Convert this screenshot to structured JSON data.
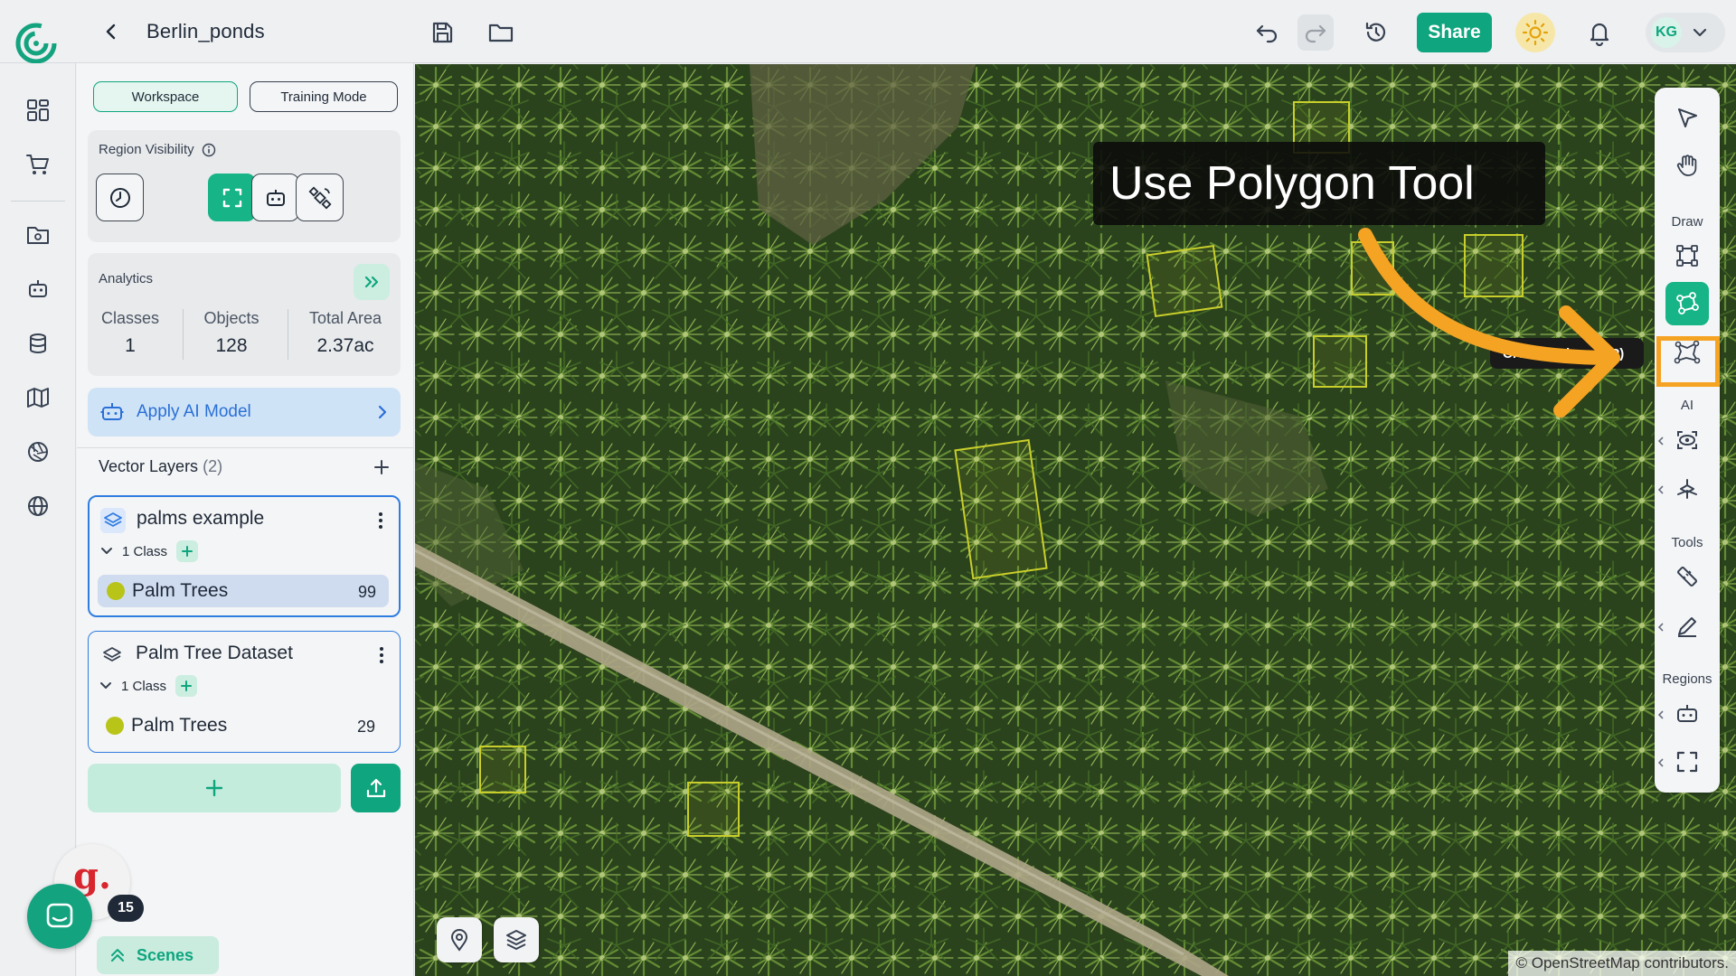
{
  "header": {
    "project_title": "Berlin_ponds",
    "share_label": "Share",
    "avatar_initials": "KG"
  },
  "panel": {
    "modes": {
      "workspace": "Workspace",
      "training": "Training Mode"
    },
    "region_visibility": {
      "title": "Region Visibility"
    },
    "analytics": {
      "title": "Analytics",
      "stats": [
        {
          "label": "Classes",
          "value": "1"
        },
        {
          "label": "Objects",
          "value": "128"
        },
        {
          "label": "Total Area",
          "value": "2.37ac"
        }
      ]
    },
    "apply_ai_label": "Apply AI Model",
    "vector_layers": {
      "title": "Vector Layers",
      "count": "(2)",
      "layers": [
        {
          "name": "palms example",
          "class_summary": "1 Class",
          "classes": [
            {
              "name": "Palm Trees",
              "count": "99"
            }
          ]
        },
        {
          "name": "Palm Tree Dataset",
          "class_summary": "1 Class",
          "classes": [
            {
              "name": "Palm Trees",
              "count": "29"
            }
          ]
        }
      ]
    },
    "scenes_label": "Scenes"
  },
  "floating": {
    "help_letter": "g.",
    "notification_count": "15"
  },
  "map": {
    "tooltip_big": "Use Polygon Tool",
    "tooltip_small": "Create Polygon (P)",
    "attribution": "© OpenStreetMap contributors."
  },
  "tools": {
    "sections": {
      "draw": "Draw",
      "ai": "AI",
      "tools": "Tools",
      "regions": "Regions"
    }
  },
  "colors": {
    "accent": "#0fa57e",
    "link_blue": "#2a6fd6",
    "class_color": "#b8c418",
    "bbox_color": "#c9cf2a",
    "annotation_orange": "#f5a323"
  }
}
